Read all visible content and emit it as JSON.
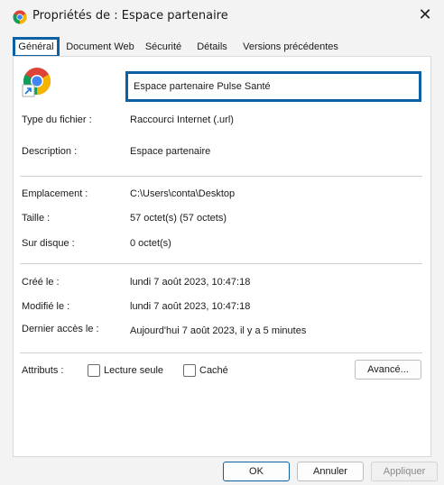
{
  "window": {
    "title": "Propriétés de : Espace partenaire",
    "close_glyph": "✕",
    "icon": "chrome-icon"
  },
  "tabs": [
    {
      "label": "Général",
      "active": true
    },
    {
      "label": "Document Web",
      "active": false
    },
    {
      "label": "Sécurité",
      "active": false
    },
    {
      "label": "Détails",
      "active": false
    },
    {
      "label": "Versions précédentes",
      "active": false
    }
  ],
  "general": {
    "name_value": "Espace partenaire Pulse Santé",
    "file_type": {
      "label": "Type du fichier :",
      "value": "Raccourci Internet (.url)"
    },
    "description": {
      "label": "Description :",
      "value": "Espace partenaire"
    },
    "location": {
      "label": "Emplacement :",
      "value": "C:\\Users\\conta\\Desktop"
    },
    "size": {
      "label": "Taille :",
      "value": "57 octet(s) (57 octets)"
    },
    "size_on_disk": {
      "label": "Sur disque :",
      "value": "0 octet(s)"
    },
    "created": {
      "label": "Créé le :",
      "value": "lundi 7 août 2023, 10:47:18"
    },
    "modified": {
      "label": "Modifié le :",
      "value": "lundi 7 août 2023, 10:47:18"
    },
    "accessed": {
      "label": "Dernier accès le :",
      "value": "Aujourd'hui 7 août 2023, il y a 5 minutes"
    },
    "attributes": {
      "label": "Attributs :",
      "readonly_label": "Lecture seule",
      "readonly_checked": false,
      "hidden_label": "Caché",
      "hidden_checked": false,
      "advanced_button": "Avancé..."
    }
  },
  "footer": {
    "ok": "OK",
    "cancel": "Annuler",
    "apply": "Appliquer"
  },
  "colors": {
    "highlight": "#0b61a4",
    "background": "#f3f3f3",
    "panel": "#ffffff"
  }
}
